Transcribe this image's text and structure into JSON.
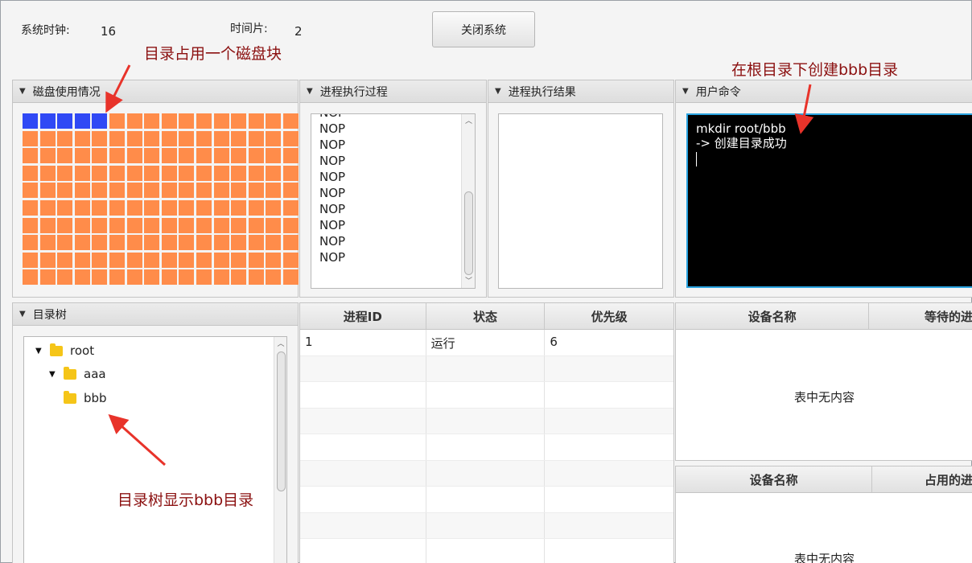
{
  "header": {
    "clock_label": "系统时钟:",
    "clock_value": "16",
    "slice_label": "时间片:",
    "slice_value": "2",
    "close_button": "关闭系统"
  },
  "panels": {
    "disk": "磁盘使用情况",
    "exec_process": "进程执行过程",
    "exec_result": "进程执行结果",
    "user_cmd": "用户命令",
    "dir_tree": "目录树"
  },
  "disk": {
    "used_blocks": 5,
    "colors": {
      "used": "#3049f5",
      "free": "#ff8c4a"
    }
  },
  "process_log": [
    "NOP",
    "NOP",
    "NOP",
    "NOP",
    "NOP",
    "NOP",
    "NOP",
    "NOP",
    "NOP",
    "NOP"
  ],
  "console": {
    "line1": "mkdir root/bbb",
    "line2": "-> 创建目录成功"
  },
  "tree": {
    "root": "root",
    "child": "aaa",
    "grandchild": "bbb"
  },
  "process_table": {
    "headers": [
      "进程ID",
      "状态",
      "优先级"
    ],
    "rows": [
      [
        "1",
        "运行",
        "6"
      ]
    ]
  },
  "device_wait_table": {
    "headers": [
      "设备名称",
      "等待的进"
    ],
    "empty": "表中无内容"
  },
  "device_use_table": {
    "headers": [
      "设备名称",
      "占用的进"
    ],
    "empty": "表中无内容"
  },
  "annotations": {
    "disk_note": "目录占用一个磁盘块",
    "cmd_note": "在根目录下创建bbb目录",
    "tree_note": "目录树显示bbb目录"
  }
}
